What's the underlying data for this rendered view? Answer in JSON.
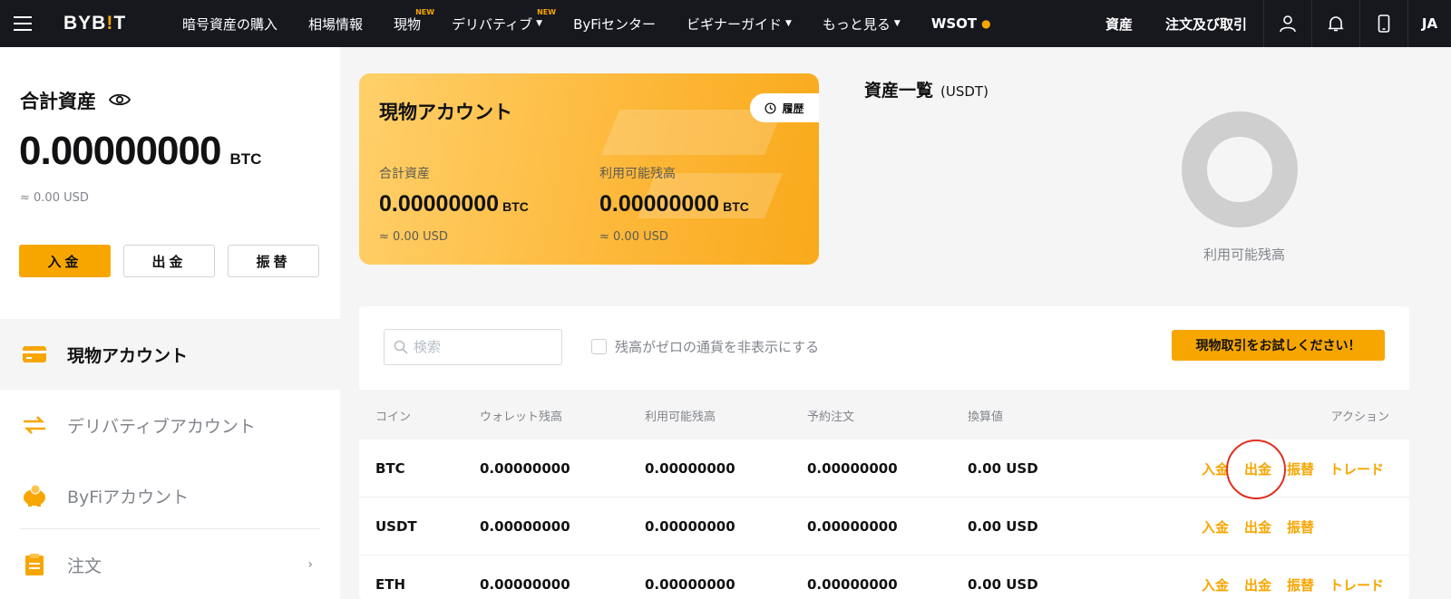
{
  "nav": {
    "logo_a": "BYB",
    "logo_bang": "!",
    "logo_b": "T",
    "items": [
      {
        "label": "暗号資産の購入",
        "new": "",
        "caret": false
      },
      {
        "label": "相場情報",
        "new": "",
        "caret": false
      },
      {
        "label": "現物",
        "new": "NEW",
        "caret": false
      },
      {
        "label": "デリバティブ",
        "new": "NEW",
        "caret": true
      },
      {
        "label": "ByFiセンター",
        "new": "",
        "caret": false
      },
      {
        "label": "ビギナーガイド",
        "new": "",
        "caret": true
      },
      {
        "label": "もっと見る",
        "new": "",
        "caret": true
      },
      {
        "label": "WSOT",
        "new": "",
        "caret": false
      }
    ],
    "assets": "資産",
    "orders": "注文及び取引",
    "lang": "JA"
  },
  "sidebar": {
    "total_title": "合計資産",
    "balance": "0.00000000",
    "balance_unit": "BTC",
    "approx": "≈ 0.00 USD",
    "deposit": "入金",
    "withdraw": "出金",
    "transfer": "振替",
    "menu": [
      {
        "label": "現物アカウント"
      },
      {
        "label": "デリバティブアカウント"
      },
      {
        "label": "ByFiアカウント"
      },
      {
        "label": "注文"
      }
    ]
  },
  "spot": {
    "title": "現物アカウント",
    "history": "履歴",
    "total_label": "合計資産",
    "total_value": "0.00000000",
    "total_unit": "BTC",
    "total_approx": "≈ 0.00 USD",
    "avail_label": "利用可能残高",
    "avail_value": "0.00000000",
    "avail_unit": "BTC",
    "avail_approx": "≈ 0.00 USD"
  },
  "overview": {
    "title": "資産一覧",
    "unit": "(USDT)",
    "donut_label": "利用可能残高",
    "donut_color": "#cfcfcf"
  },
  "table": {
    "search_placeholder": "検索",
    "hide_zero": "残高がゼロの通貨を非表示にする",
    "try_button": "現物取引をお試しください！",
    "headers": [
      "コイン",
      "ウォレット残高",
      "利用可能残高",
      "予約注文",
      "換算値",
      "アクション"
    ],
    "rows": [
      {
        "coin": "BTC",
        "wallet": "0.00000000",
        "available": "0.00000000",
        "order": "0.00000000",
        "value": "0.00 USD",
        "actions": [
          "入金",
          "出金",
          "振替",
          "トレード"
        ]
      },
      {
        "coin": "USDT",
        "wallet": "0.00000000",
        "available": "0.00000000",
        "order": "0.00000000",
        "value": "0.00 USD",
        "actions": [
          "入金",
          "出金",
          "振替"
        ]
      },
      {
        "coin": "ETH",
        "wallet": "0.00000000",
        "available": "0.00000000",
        "order": "0.00000000",
        "value": "0.00 USD",
        "actions": [
          "入金",
          "出金",
          "振替",
          "トレード"
        ]
      }
    ]
  },
  "colors": {
    "accent": "#f7a600",
    "nav_bg": "#17181e",
    "highlight_circle": "#e0301e"
  }
}
